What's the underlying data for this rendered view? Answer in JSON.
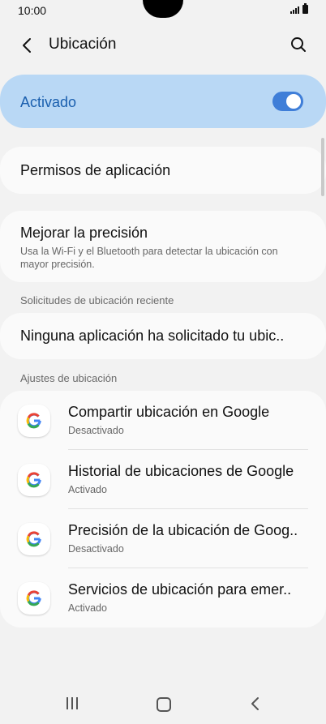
{
  "status_bar": {
    "time": "10:00"
  },
  "header": {
    "title": "Ubicación"
  },
  "master_switch": {
    "label": "Activado",
    "on": true
  },
  "app_permissions": {
    "label": "Permisos de aplicación"
  },
  "accuracy": {
    "title": "Mejorar la precisión",
    "subtitle": "Usa la Wi-Fi y el Bluetooth para detectar la ubicación con mayor precisión."
  },
  "recent_requests": {
    "header": "Solicitudes de ubicación reciente",
    "item": "Ninguna aplicación ha solicitado tu ubic.."
  },
  "location_settings": {
    "header": "Ajustes de ubicación",
    "items": [
      {
        "title": "Compartir ubicación en Google",
        "status": "Desactivado",
        "icon": "google-icon"
      },
      {
        "title": "Historial de ubicaciones de Google",
        "status": "Activado",
        "icon": "google-icon"
      },
      {
        "title": "Precisión de la ubicación de Goog..",
        "status": "Desactivado",
        "icon": "google-icon"
      },
      {
        "title": "Servicios de ubicación para emer..",
        "status": "Activado",
        "icon": "google-icon"
      }
    ]
  },
  "colors": {
    "accent": "#3f7ed8",
    "master_bg": "#b9d8f5",
    "master_text": "#1a5fae",
    "background": "#f2f2f2"
  }
}
